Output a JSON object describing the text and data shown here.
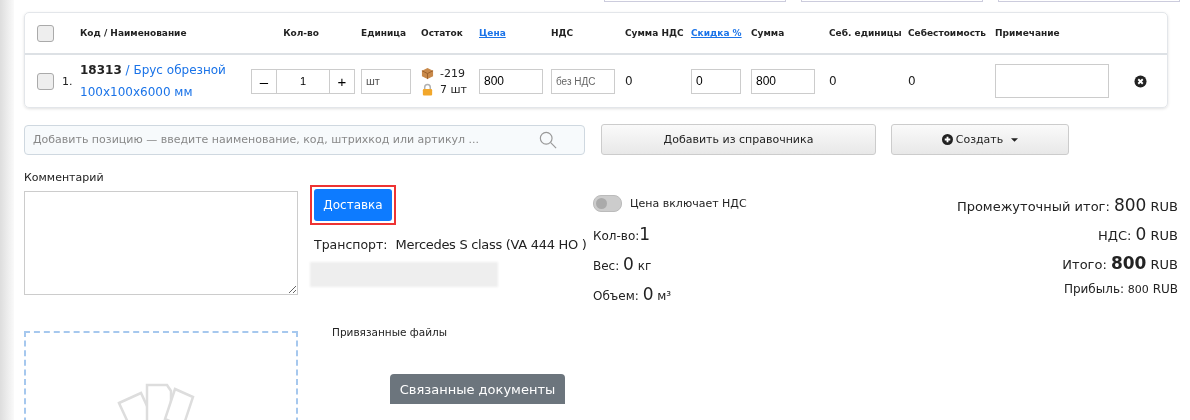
{
  "table": {
    "select_all": {
      "checked": false
    },
    "columns": [
      {
        "label": "Код / Наименование",
        "link": false
      },
      {
        "label": "Кол-во",
        "link": false
      },
      {
        "label": "Единица",
        "link": false
      },
      {
        "label": "Остаток",
        "link": false
      },
      {
        "label": "Цена",
        "link": true
      },
      {
        "label": "НДС",
        "link": false
      },
      {
        "label": "Сумма НДС",
        "link": false
      },
      {
        "label": "Скидка %",
        "link": true
      },
      {
        "label": "Сумма",
        "link": false
      },
      {
        "label": "Себ. единицы",
        "link": false
      },
      {
        "label": "Себестоимость",
        "link": false
      },
      {
        "label": "Примечание",
        "link": false
      }
    ],
    "rows": [
      {
        "checked": false,
        "number": "1.",
        "title": "**18313** / Брус обрезной 100x100x6000 мм",
        "qty": "1",
        "minus": "–",
        "plus": "+",
        "unit": "шт",
        "stock": "-219",
        "reserved": "7 шт",
        "price": "800",
        "vat": "без НДС",
        "vat_sum": "0",
        "discount": "0",
        "sum": "800",
        "unit_cost": "0",
        "cost": "0"
      }
    ]
  },
  "add_search": {
    "placeholder": "Добавить позицию — введите наименование, код, штрихкод или артикул ..."
  },
  "add_from_catalog": "Добавить из справочника",
  "create_button": "Создать",
  "comment_label": "Комментарий",
  "delivery_button": "Доставка",
  "transport": {
    "label": "Транспорт:",
    "value": "Mercedes S class (VA 444 HO )"
  },
  "price_includes_vat": {
    "label": "Цена включает НДС",
    "on": false
  },
  "stats": [
    {
      "label": "Кол-во:",
      "value": "1"
    },
    {
      "label": "Вес: ",
      "value": "0",
      "unit": " кг"
    },
    {
      "label": "Объем: ",
      "value": "0",
      "unit": " м³"
    }
  ],
  "totals": [
    {
      "kind": "normal",
      "label": "Промежуточный итог: ",
      "value": "800",
      "currency": " RUB"
    },
    {
      "kind": "normal",
      "label": "НДС: ",
      "value": "0",
      "currency": " RUB"
    },
    {
      "kind": "bold",
      "label": "Итого: ",
      "value": "800",
      "currency": " RUB"
    },
    {
      "kind": "small",
      "label": "Прибыль: ",
      "value": "800",
      "currency": " RUB"
    }
  ],
  "attached_files_label": "Привязанные файлы",
  "related_docs_button": "Связанные документы"
}
